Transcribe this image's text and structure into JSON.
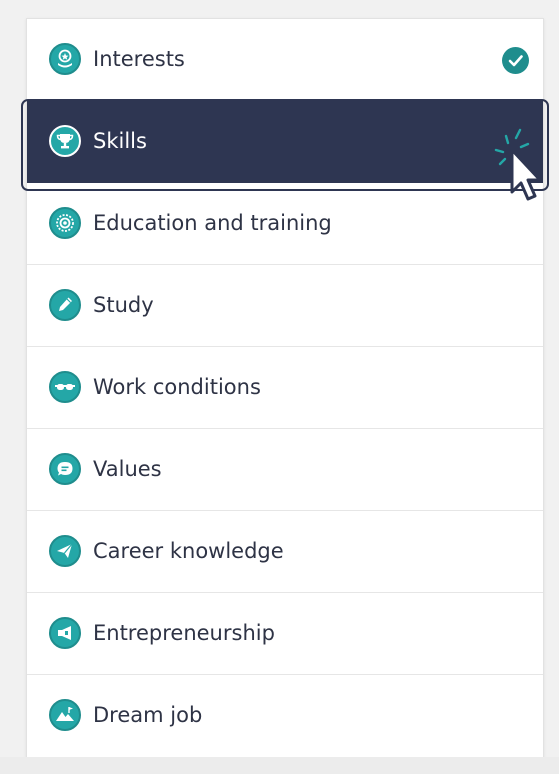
{
  "menu": {
    "items": [
      {
        "label": "Interests",
        "icon": "interests-icon",
        "completed": true
      },
      {
        "label": "Skills",
        "icon": "trophy-icon",
        "selected": true
      },
      {
        "label": "Education and training",
        "icon": "badge-icon"
      },
      {
        "label": "Study",
        "icon": "pencil-icon"
      },
      {
        "label": "Work conditions",
        "icon": "goggles-icon"
      },
      {
        "label": "Values",
        "icon": "chat-icon"
      },
      {
        "label": "Career knowledge",
        "icon": "paper-plane-icon"
      },
      {
        "label": "Entrepreneurship",
        "icon": "megaphone-icon"
      },
      {
        "label": "Dream job",
        "icon": "mountain-icon"
      }
    ]
  },
  "colors": {
    "teal": "#24a7a7",
    "teal_dark": "#1f8d8d",
    "navy": "#2e3652",
    "text": "#2e3345"
  }
}
